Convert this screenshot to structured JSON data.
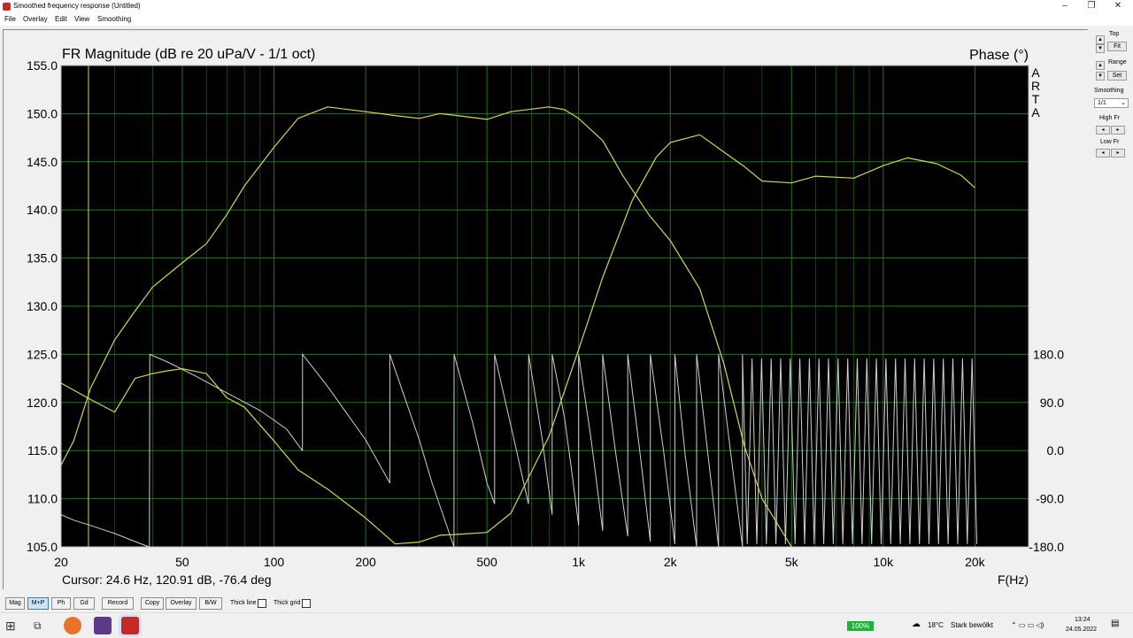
{
  "window": {
    "title": "Smoothed frequency response (Untitled)",
    "minimize": "–",
    "maximize": "❐",
    "close": "✕"
  },
  "menu": [
    "File",
    "Overlay",
    "Edit",
    "View",
    "Smoothing"
  ],
  "side_panel": {
    "top_label": "Top",
    "fit_label": "Fit",
    "range_label": "Range",
    "set_label": "Set",
    "smoothing_label": "Smoothing",
    "smoothing_value": "1/1",
    "high_fr_label": "High Fr",
    "low_fr_label": "Low Fr"
  },
  "bottom_bar": {
    "buttons": [
      "Mag",
      "M+P",
      "Ph",
      "Gd",
      "Record",
      "Copy",
      "Overlay",
      "B/W"
    ],
    "active": "M+P",
    "thick_line": "Thick line",
    "thick_grid": "Thick grid"
  },
  "taskbar": {
    "battery": "100%",
    "temperature": "18°C",
    "weather": "Stark bewölkt",
    "time": "13:24",
    "date": "24.05.2022"
  },
  "colors": {
    "plot_bg": "#000000",
    "grid": "#1e7a1e",
    "magnitude": "#d6d650",
    "phase": "#d0d0d0",
    "frame_bg": "#f0f0f0"
  },
  "chart_data": {
    "type": "line",
    "title": "FR Magnitude (dB re 20 uPa/V - 1/1 oct)",
    "right_title": "Phase (°)",
    "watermark": "ARTA",
    "xlabel": "F(Hz)",
    "cursor_text": "Cursor: 24.6 Hz, 120.91 dB, -76.4 deg",
    "cursor_x": 24.6,
    "x_scale": "log",
    "xlim": [
      20,
      30000
    ],
    "x_ticks": [
      20,
      50,
      100,
      200,
      500,
      1000,
      2000,
      5000,
      10000,
      20000
    ],
    "x_tick_labels": [
      "20",
      "50",
      "100",
      "200",
      "500",
      "1k",
      "2k",
      "5k",
      "10k",
      "20k"
    ],
    "ylim": [
      105,
      155
    ],
    "y_ticks": [
      105,
      110,
      115,
      120,
      125,
      130,
      135,
      140,
      145,
      150,
      155
    ],
    "y_tick_labels": [
      "105.0",
      "110.0",
      "115.0",
      "120.0",
      "125.0",
      "130.0",
      "135.0",
      "140.0",
      "145.0",
      "150.0",
      "155.0"
    ],
    "phase_ticks": [
      180,
      90,
      0,
      -90,
      -180
    ],
    "phase_tick_labels": [
      "180.0",
      "90.0",
      "0.0",
      "-90.0",
      "-180.0"
    ],
    "series": [
      {
        "axis": "left",
        "x": [
          20,
          22,
          25,
          30,
          35,
          40,
          50,
          60,
          70,
          80,
          100,
          120,
          150,
          200,
          250,
          300,
          350,
          400,
          500,
          600,
          800,
          900,
          1000,
          1200,
          1400,
          1700,
          2000,
          2500,
          3000,
          3500,
          4000,
          5000
        ],
        "values": [
          113.5,
          116,
          121.5,
          126.5,
          129.5,
          132,
          134.5,
          136.5,
          139.5,
          142.5,
          146.5,
          149.5,
          150.7,
          150.2,
          149.8,
          149.5,
          150.0,
          149.8,
          149.4,
          150.2,
          150.7,
          150.4,
          149.5,
          147.2,
          143.5,
          139.5,
          136.8,
          131.8,
          124.0,
          115.5,
          110.0,
          105.0
        ]
      },
      {
        "axis": "left",
        "x": [
          20,
          25,
          30,
          35,
          40,
          45,
          50,
          60,
          70,
          80,
          100,
          120,
          150,
          200,
          250,
          300,
          350,
          400,
          500,
          600,
          800,
          1000,
          1200,
          1500,
          1800,
          2000,
          2500,
          3000,
          3500,
          4000,
          5000,
          6000,
          8000,
          10000,
          12000,
          15000,
          18000,
          20000
        ],
        "values": [
          122.0,
          120.3,
          119.0,
          122.5,
          123.0,
          123.3,
          123.5,
          123.0,
          120.5,
          119.5,
          116.0,
          113.0,
          111.0,
          108.0,
          105.3,
          105.5,
          106.2,
          106.3,
          106.5,
          108.5,
          116.5,
          125.5,
          133.0,
          141.0,
          145.5,
          147.0,
          147.8,
          146.0,
          144.5,
          143.0,
          142.8,
          143.5,
          143.3,
          144.6,
          145.4,
          144.8,
          143.6,
          142.3
        ]
      }
    ],
    "phase_series": {
      "axis": "right",
      "x": [
        20,
        22,
        25,
        30,
        35,
        38.9,
        39,
        39.1,
        45,
        55,
        70,
        90,
        110,
        123.9,
        124,
        124.1,
        150,
        200,
        239.9,
        240,
        240.1,
        300,
        330,
        389.9,
        390,
        390.1,
        450,
        500,
        529.9,
        530,
        530.1,
        620,
        660,
        684.9,
        685,
        685.1,
        760,
        818.9,
        819,
        819.1,
        900,
        950,
        999.9,
        1000,
        1000.1,
        1100,
        1199.9,
        1200,
        1200.1,
        1320,
        1449.9,
        1450,
        1450.1,
        1580,
        1719.9,
        1720,
        1720.1,
        1900,
        2069.9,
        2070,
        2070.1,
        2240,
        2439.9,
        2440,
        2440.1,
        2650,
        2879.9,
        2880,
        2880.1,
        3150,
        3449.9,
        3450,
        3450.1
      ],
      "values": [
        -120,
        -130,
        -140,
        -155,
        -170,
        -180,
        -180,
        180,
        165,
        140,
        108,
        75,
        40,
        0,
        0,
        180,
        120,
        20,
        -60,
        -60,
        180,
        20,
        -60,
        -180,
        -180,
        180,
        50,
        -60,
        -100,
        -100,
        180,
        10,
        -60,
        -100,
        -100,
        180,
        20,
        -120,
        -120,
        180,
        60,
        -40,
        -140,
        -140,
        180,
        20,
        -150,
        -150,
        180,
        0,
        -160,
        -160,
        180,
        10,
        -170,
        -170,
        180,
        0,
        -175,
        -175,
        180,
        -10,
        -180,
        -180,
        180,
        0,
        -180,
        -180,
        180,
        0,
        -180,
        -180,
        180
      ]
    },
    "phase_dense": {
      "from": 3450,
      "to": 20000,
      "period_ratio": 1.075,
      "min": -180,
      "max": 180
    }
  }
}
